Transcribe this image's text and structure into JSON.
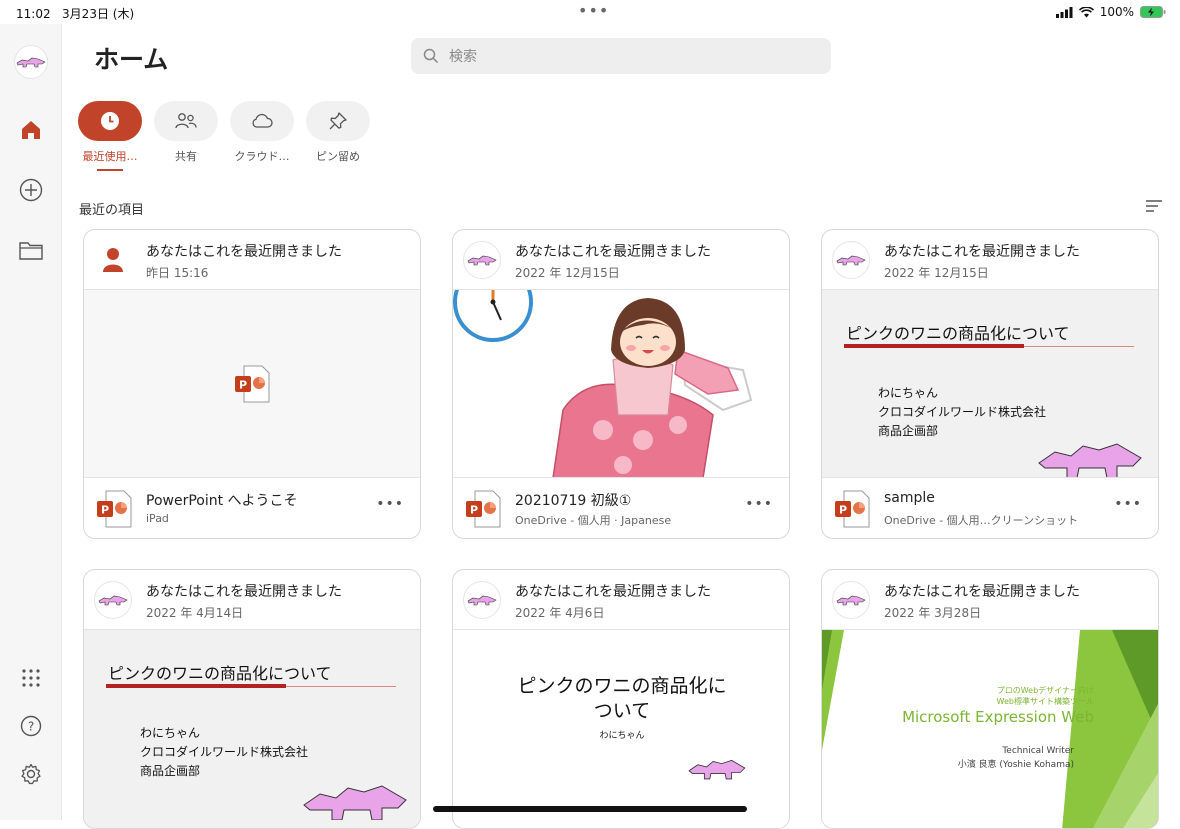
{
  "status": {
    "time": "11:02",
    "date": "3月23日 (木)",
    "battery": "100%"
  },
  "header": {
    "title": "ホーム",
    "search_placeholder": "検索"
  },
  "filters": [
    {
      "label": "最近使用…",
      "icon": "clock-icon",
      "active": true
    },
    {
      "label": "共有",
      "icon": "people-icon",
      "active": false
    },
    {
      "label": "クラウド…",
      "icon": "cloud-icon",
      "active": false
    },
    {
      "label": "ピン留め",
      "icon": "pin-icon",
      "active": false
    }
  ],
  "section": {
    "title": "最近の項目"
  },
  "cards": [
    {
      "opened": "あなたはこれを最近開きました",
      "date": "昨日 15:16",
      "name": "PowerPoint へようこそ",
      "location": "iPad"
    },
    {
      "opened": "あなたはこれを最近開きました",
      "date": "2022 年 12月15日",
      "name": "20210719 初級①",
      "location": "OneDrive - 個人用 · Japanese"
    },
    {
      "opened": "あなたはこれを最近開きました",
      "date": "2022 年 12月15日",
      "name": "sample",
      "location": "OneDrive - 個人用…クリーンショット",
      "slide": {
        "title": "ピンクのワニの商品化について",
        "lines": [
          "わにちゃん",
          "クロコダイルワールド株式会社",
          "商品企画部"
        ]
      }
    },
    {
      "opened": "あなたはこれを最近開きました",
      "date": "2022 年 4月14日",
      "slide": {
        "title": "ピンクのワニの商品化について",
        "lines": [
          "わにちゃん",
          "クロコダイルワールド株式会社",
          "商品企画部"
        ]
      }
    },
    {
      "opened": "あなたはこれを最近開きました",
      "date": "2022 年 4月6日",
      "slide": {
        "title_line1": "ピンクのワニの商品化に",
        "title_line2": "ついて",
        "subtitle": "わにちゃん"
      }
    },
    {
      "opened": "あなたはこれを最近開きました",
      "date": "2022 年 3月28日",
      "slide": {
        "kicker1": "プロのWebデザイナー向け",
        "kicker2": "Web標準サイト構築ツール",
        "title": "Microsoft Expression Web",
        "role": "Technical Writer",
        "author": "小濱 良恵 (Yoshie Kohama)"
      }
    }
  ],
  "colors": {
    "accent": "#c0432a",
    "croc": "#e9a3e9",
    "ppt": "#c43e1c"
  }
}
